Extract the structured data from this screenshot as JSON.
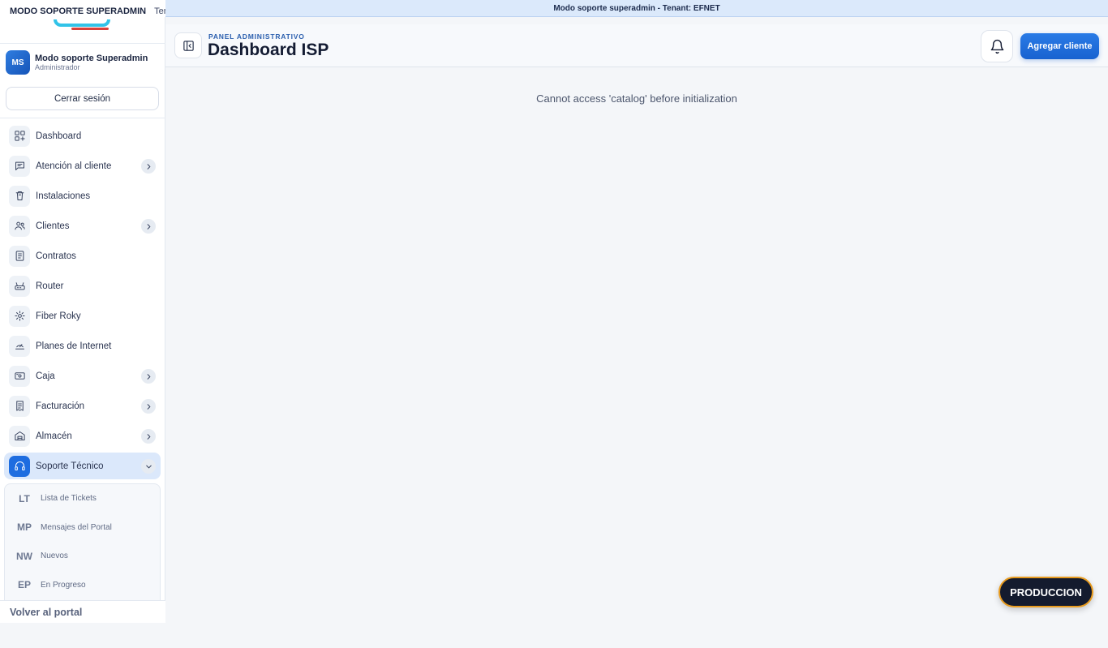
{
  "topbar": {
    "mode_label": "MODO SOPORTE SUPERADMIN",
    "tenant_label": "Tenant",
    "banner_text": "Modo soporte superadmin - Tenant: EFNET"
  },
  "user": {
    "initials": "MS",
    "name": "Modo soporte Superadmin",
    "role": "Administrador"
  },
  "logout_label": "Cerrar sesión",
  "sidebar": {
    "items": [
      {
        "label": "Dashboard",
        "icon": "grid-icon",
        "has_chevron": false
      },
      {
        "label": "Atención al cliente",
        "icon": "chat-icon",
        "has_chevron": true
      },
      {
        "label": "Instalaciones",
        "icon": "trash-icon",
        "has_chevron": false
      },
      {
        "label": "Clientes",
        "icon": "users-icon",
        "has_chevron": true
      },
      {
        "label": "Contratos",
        "icon": "document-icon",
        "has_chevron": false
      },
      {
        "label": "Router",
        "icon": "router-icon",
        "has_chevron": false
      },
      {
        "label": "Fiber Roky",
        "icon": "sun-icon",
        "has_chevron": false
      },
      {
        "label": "Planes de Internet",
        "icon": "speed-icon",
        "has_chevron": false
      },
      {
        "label": "Caja",
        "icon": "cash-icon",
        "has_chevron": true
      },
      {
        "label": "Facturación",
        "icon": "invoice-icon",
        "has_chevron": true
      },
      {
        "label": "Almacén",
        "icon": "warehouse-icon",
        "has_chevron": true
      },
      {
        "label": "Soporte Técnico",
        "icon": "headset-icon",
        "has_chevron": true,
        "active": true
      }
    ],
    "subitems": [
      {
        "abbr": "LT",
        "label": "Lista de Tickets"
      },
      {
        "abbr": "MP",
        "label": "Mensajes del Portal"
      },
      {
        "abbr": "NW",
        "label": "Nuevos"
      },
      {
        "abbr": "EP",
        "label": "En Progreso"
      }
    ],
    "back_portal": "Volver al portal"
  },
  "header": {
    "eyebrow": "PANEL ADMINISTRATIVO",
    "title": "Dashboard ISP",
    "add_button": "Agregar cliente"
  },
  "main": {
    "error_message": "Cannot access 'catalog' before initialization"
  },
  "env_badge": "PRODUCCION",
  "colors": {
    "accent": "#1e6de0",
    "banner_bg": "#dbe9fb",
    "badge_border": "#e89b1e"
  }
}
